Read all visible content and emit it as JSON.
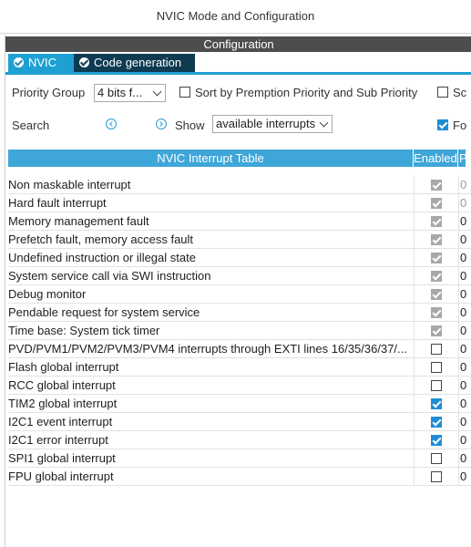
{
  "window": {
    "title": "NVIC Mode and Configuration"
  },
  "config": {
    "header": "Configuration"
  },
  "tabs": [
    {
      "label": "NVIC",
      "icon": "check-circle-icon"
    },
    {
      "label": "Code generation",
      "icon": "check-circle-icon"
    }
  ],
  "controls": {
    "priority_group_label": "Priority Group",
    "priority_group_value": "4 bits f...",
    "sort_label": "Sort by Premption Priority and Sub Priority",
    "sort_checked": false,
    "extra_checkbox_label": "Sc",
    "extra_checkbox_checked": false,
    "search_label": "Search",
    "show_label": "Show",
    "show_value": "available interrupts",
    "fo_label": "Fo",
    "fo_checked": true
  },
  "table": {
    "col_name": "NVIC Interrupt Table",
    "col_enabled": "Enabled",
    "col_priority": "P",
    "rows": [
      {
        "name": "Non maskable interrupt",
        "enabled": "locked",
        "priority": "0"
      },
      {
        "name": "Hard fault interrupt",
        "enabled": "locked",
        "priority": "0"
      },
      {
        "name": "Memory management fault",
        "enabled": "locked",
        "priority": "0"
      },
      {
        "name": "Prefetch fault, memory access fault",
        "enabled": "locked",
        "priority": "0"
      },
      {
        "name": "Undefined instruction or illegal state",
        "enabled": "locked",
        "priority": "0"
      },
      {
        "name": "System service call via SWI instruction",
        "enabled": "locked",
        "priority": "0"
      },
      {
        "name": "Debug monitor",
        "enabled": "locked",
        "priority": "0"
      },
      {
        "name": "Pendable request for system service",
        "enabled": "locked",
        "priority": "0"
      },
      {
        "name": "Time base: System tick timer",
        "enabled": "locked",
        "priority": "0"
      },
      {
        "name": "PVD/PVM1/PVM2/PVM3/PVM4 interrupts through EXTI lines 16/35/36/37/...",
        "enabled": "off",
        "priority": "0"
      },
      {
        "name": "Flash global interrupt",
        "enabled": "off",
        "priority": "0"
      },
      {
        "name": "RCC global interrupt",
        "enabled": "off",
        "priority": "0"
      },
      {
        "name": "TIM2 global interrupt",
        "enabled": "on",
        "priority": "0"
      },
      {
        "name": "I2C1 event interrupt",
        "enabled": "on",
        "priority": "0"
      },
      {
        "name": "I2C1 error interrupt",
        "enabled": "on",
        "priority": "0"
      },
      {
        "name": "SPI1 global interrupt",
        "enabled": "off",
        "priority": "0"
      },
      {
        "name": "FPU global interrupt",
        "enabled": "off",
        "priority": "0"
      }
    ]
  },
  "colors": {
    "tab_active": "#1ea0d2",
    "tab_inactive": "#0f3b52",
    "header_dark": "#4d4d4d",
    "table_header": "#3fa6d9",
    "checkbox_checked": "#1f8dd6",
    "checkbox_locked": "#a8a8a8"
  }
}
